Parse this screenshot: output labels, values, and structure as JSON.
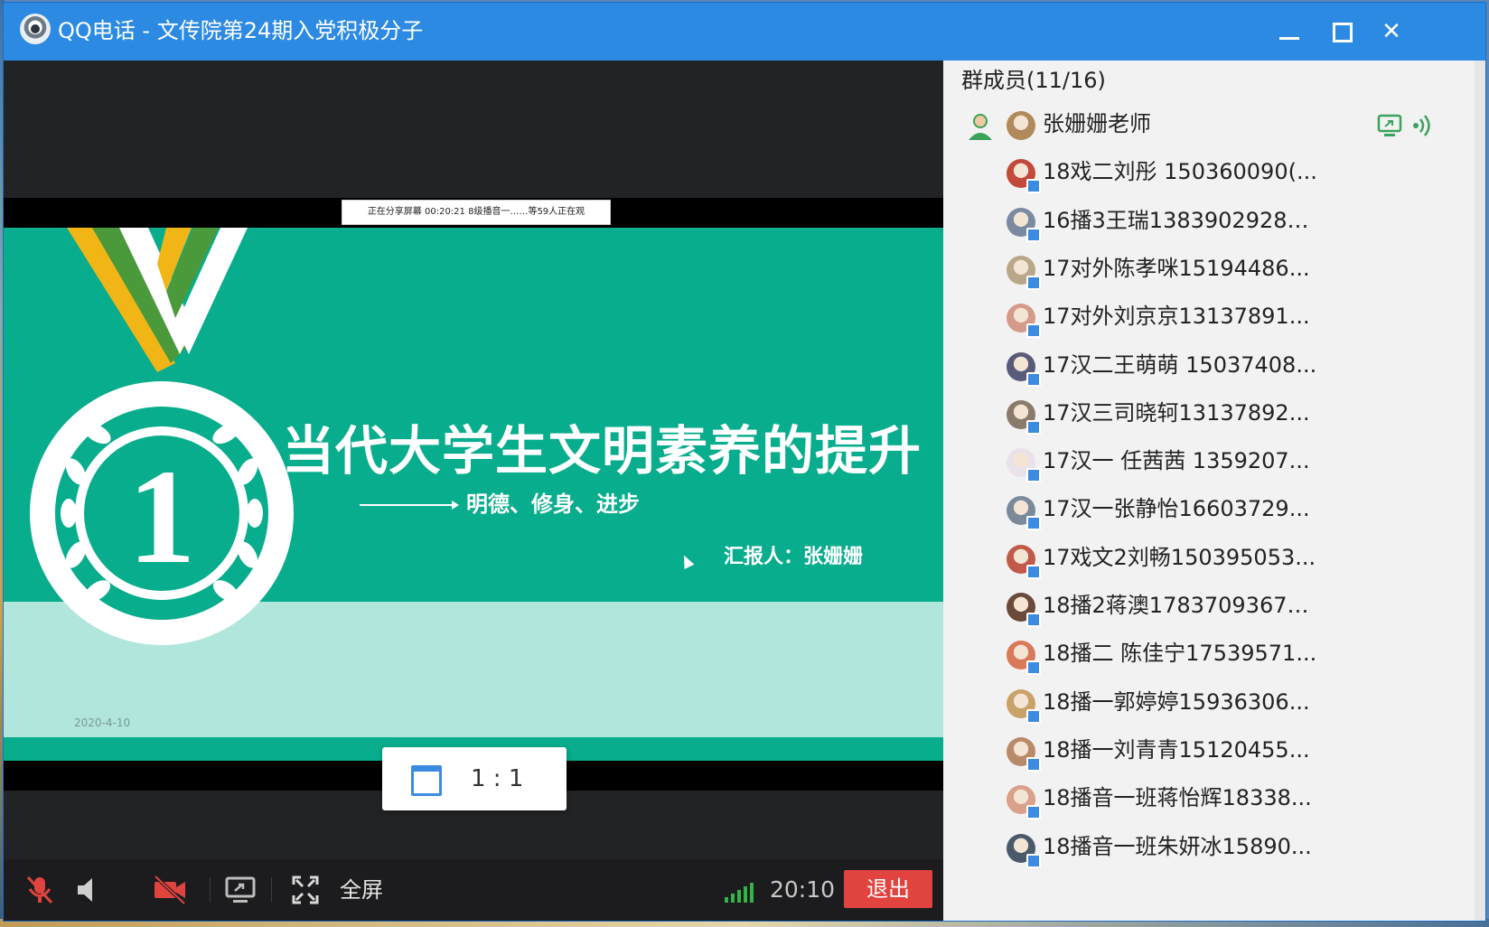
{
  "window": {
    "title": "QQ电话 - 文传院第24期入党积极分子"
  },
  "share": {
    "status_bar": "正在分享屏幕  00:20:21    8级播音一……等59人正在观"
  },
  "slide": {
    "title": "当代大学生文明素养的提升",
    "subtitle": "明德、修身、进步",
    "reporter": "汇报人：张姗姗",
    "medal_number": "1",
    "date": "2020-4-10"
  },
  "ratio_popup": {
    "label": "1 : 1"
  },
  "toolbar": {
    "fullscreen_label": "全屏",
    "time": "20:10",
    "exit_label": "退出",
    "icons": [
      "mic-muted-icon",
      "speaker-icon",
      "camera-off-icon",
      "share-screen-icon",
      "fullscreen-icon",
      "signal-icon"
    ],
    "exit_color": "#e1433f",
    "signal_color": "#33b34a"
  },
  "members": {
    "title": "群成员(11/16)",
    "list": [
      {
        "name": "张姗姗老师",
        "host": true,
        "avatar_color": "#b08a5a"
      },
      {
        "name": "18戏二刘彤 150360090(...",
        "avatar_color": "#c24a3a"
      },
      {
        "name": "16播3王瑞1383902928…",
        "avatar_color": "#7a8aa0"
      },
      {
        "name": "17对外陈孝咪15194486...",
        "avatar_color": "#b9a78a"
      },
      {
        "name": "17对外刘京京13137891...",
        "avatar_color": "#d49a8a"
      },
      {
        "name": "17汉二王萌萌 15037408...",
        "avatar_color": "#5a5a7a"
      },
      {
        "name": "17汉三司晓轲13137892...",
        "avatar_color": "#8a7a6a"
      },
      {
        "name": "17汉一 任茜茜 1359207...",
        "avatar_color": "#e9e2e8"
      },
      {
        "name": "17汉一张静怡16603729...",
        "avatar_color": "#7a8a9a"
      },
      {
        "name": "17戏文2刘畅150395053...",
        "avatar_color": "#c25a4a"
      },
      {
        "name": "18播2蒋澳1783709367…",
        "avatar_color": "#6a4a3a"
      },
      {
        "name": "18播二 陈佳宁17539571...",
        "avatar_color": "#d87a5a"
      },
      {
        "name": "18播一郭婷婷15936306...",
        "avatar_color": "#c9a26a"
      },
      {
        "name": "18播一刘青青15120455...",
        "avatar_color": "#b98a6a"
      },
      {
        "name": "18播音一班蒋怡辉18338...",
        "avatar_color": "#d9a08a"
      },
      {
        "name": "18播音一班朱妍冰15890...",
        "avatar_color": "#4a5a6a"
      }
    ]
  },
  "colors": {
    "titlebar": "#2c8ae3",
    "slide_green": "#07ad8c",
    "slide_light": "#b0e6dc",
    "panel_bg": "#f2f2f2"
  }
}
